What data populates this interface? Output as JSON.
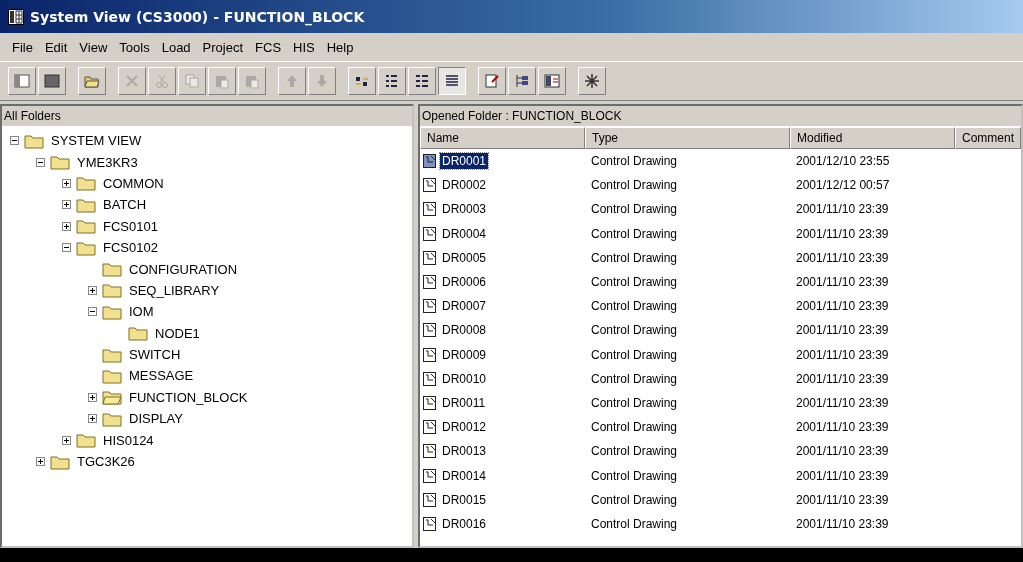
{
  "window": {
    "title": "System View (CS3000) - FUNCTION_BLOCK"
  },
  "menu": [
    "File",
    "Edit",
    "View",
    "Tools",
    "Load",
    "Project",
    "FCS",
    "HIS",
    "Help"
  ],
  "toolbar": [
    {
      "kind": "window",
      "disabled": false,
      "selected": false
    },
    {
      "kind": "panel",
      "disabled": false,
      "selected": false
    },
    {
      "kind": "open",
      "disabled": false,
      "selected": false
    },
    {
      "kind": "delete",
      "disabled": true,
      "selected": false
    },
    {
      "kind": "cut",
      "disabled": true,
      "selected": false
    },
    {
      "kind": "copy",
      "disabled": true,
      "selected": false
    },
    {
      "kind": "paste",
      "disabled": true,
      "selected": false
    },
    {
      "kind": "paste",
      "disabled": true,
      "selected": false
    },
    {
      "kind": "up",
      "disabled": true,
      "selected": false
    },
    {
      "kind": "down",
      "disabled": true,
      "selected": false
    },
    {
      "kind": "largeicons",
      "disabled": false,
      "selected": false
    },
    {
      "kind": "smallicons",
      "disabled": false,
      "selected": false
    },
    {
      "kind": "list",
      "disabled": false,
      "selected": false
    },
    {
      "kind": "details",
      "disabled": false,
      "selected": true
    },
    {
      "kind": "properties",
      "disabled": false,
      "selected": false
    },
    {
      "kind": "tree",
      "disabled": false,
      "selected": false
    },
    {
      "kind": "view",
      "disabled": false,
      "selected": false
    },
    {
      "kind": "tool",
      "disabled": false,
      "selected": false
    }
  ],
  "folders": {
    "title": "All Folders",
    "tree": [
      {
        "label": "SYSTEM VIEW",
        "expanded": true,
        "children": [
          {
            "label": "YME3KR3",
            "expanded": true,
            "children": [
              {
                "label": "COMMON",
                "expanded": false
              },
              {
                "label": "BATCH",
                "expanded": false
              },
              {
                "label": "FCS0101",
                "expanded": false
              },
              {
                "label": "FCS0102",
                "expanded": true,
                "children": [
                  {
                    "label": "CONFIGURATION"
                  },
                  {
                    "label": "SEQ_LIBRARY",
                    "expanded": false
                  },
                  {
                    "label": "IOM",
                    "expanded": true,
                    "children": [
                      {
                        "label": "NODE1"
                      }
                    ]
                  },
                  {
                    "label": "SWITCH"
                  },
                  {
                    "label": "MESSAGE"
                  },
                  {
                    "label": "FUNCTION_BLOCK",
                    "expanded": false,
                    "opened": true
                  },
                  {
                    "label": "DISPLAY",
                    "expanded": false
                  }
                ]
              },
              {
                "label": "HIS0124",
                "expanded": false
              }
            ]
          },
          {
            "label": "TGC3K26",
            "expanded": false
          }
        ]
      }
    ]
  },
  "contents": {
    "title": "Opened Folder : FUNCTION_BLOCK",
    "columns": [
      "Name",
      "Type",
      "Modified",
      "Comment"
    ],
    "rows": [
      {
        "name": "DR0001",
        "type": "Control Drawing",
        "modified": "2001/12/10 23:55",
        "selected": true
      },
      {
        "name": "DR0002",
        "type": "Control Drawing",
        "modified": "2001/12/12 00:57",
        "selected": false
      },
      {
        "name": "DR0003",
        "type": "Control Drawing",
        "modified": "2001/11/10 23:39",
        "selected": false
      },
      {
        "name": "DR0004",
        "type": "Control Drawing",
        "modified": "2001/11/10 23:39",
        "selected": false
      },
      {
        "name": "DR0005",
        "type": "Control Drawing",
        "modified": "2001/11/10 23:39",
        "selected": false
      },
      {
        "name": "DR0006",
        "type": "Control Drawing",
        "modified": "2001/11/10 23:39",
        "selected": false
      },
      {
        "name": "DR0007",
        "type": "Control Drawing",
        "modified": "2001/11/10 23:39",
        "selected": false
      },
      {
        "name": "DR0008",
        "type": "Control Drawing",
        "modified": "2001/11/10 23:39",
        "selected": false
      },
      {
        "name": "DR0009",
        "type": "Control Drawing",
        "modified": "2001/11/10 23:39",
        "selected": false
      },
      {
        "name": "DR0010",
        "type": "Control Drawing",
        "modified": "2001/11/10 23:39",
        "selected": false
      },
      {
        "name": "DR0011",
        "type": "Control Drawing",
        "modified": "2001/11/10 23:39",
        "selected": false
      },
      {
        "name": "DR0012",
        "type": "Control Drawing",
        "modified": "2001/11/10 23:39",
        "selected": false
      },
      {
        "name": "DR0013",
        "type": "Control Drawing",
        "modified": "2001/11/10 23:39",
        "selected": false
      },
      {
        "name": "DR0014",
        "type": "Control Drawing",
        "modified": "2001/11/10 23:39",
        "selected": false
      },
      {
        "name": "DR0015",
        "type": "Control Drawing",
        "modified": "2001/11/10 23:39",
        "selected": false
      },
      {
        "name": "DR0016",
        "type": "Control Drawing",
        "modified": "2001/11/10 23:39",
        "selected": false
      }
    ]
  }
}
